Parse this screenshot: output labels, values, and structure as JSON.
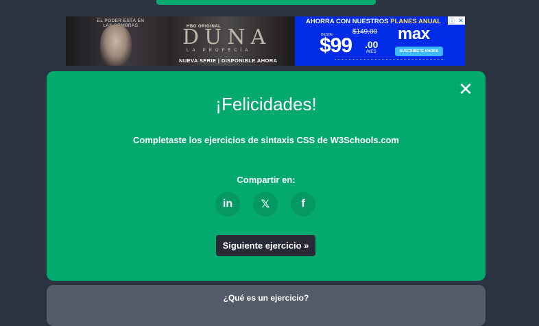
{
  "progress": {
    "value": 1.0,
    "color": "#04aa6d"
  },
  "ad": {
    "tagline": "EL PODER ESTÁ EN LAS SOMBRAS",
    "hbo_label": "HBO ORIGINAL",
    "title": "DUNA",
    "subtitle": "LA PROFECÍA",
    "footer": "NUEVA SERIE | DISPONIBLE AHORA",
    "headline_prefix": "AHORRA CON NUESTROS ",
    "headline_highlight": "PLANES ANUAL",
    "desde": "DESDE",
    "old_price": "$149.00",
    "price": "$99",
    "cents": ".00",
    "per": "/MES",
    "logo": "max",
    "cta": "SUSCRÍBETE AHORA",
    "info_icon": "info-icon",
    "close_icon": "close-icon"
  },
  "modal": {
    "title": "¡Felicidades!",
    "message": "Completaste los ejercicios de sintaxis CSS de W3Schools.com",
    "share_label": "Compartir en:",
    "share": [
      {
        "name": "linkedin",
        "glyph": "in"
      },
      {
        "name": "x",
        "glyph": "𝕏"
      },
      {
        "name": "facebook",
        "glyph": "f"
      }
    ],
    "next_button": "Siguiente ejercicio »",
    "close_glyph": "✕",
    "bg_color": "#04aa6d"
  },
  "faq": {
    "title": "¿Qué es un ejercicio?"
  }
}
